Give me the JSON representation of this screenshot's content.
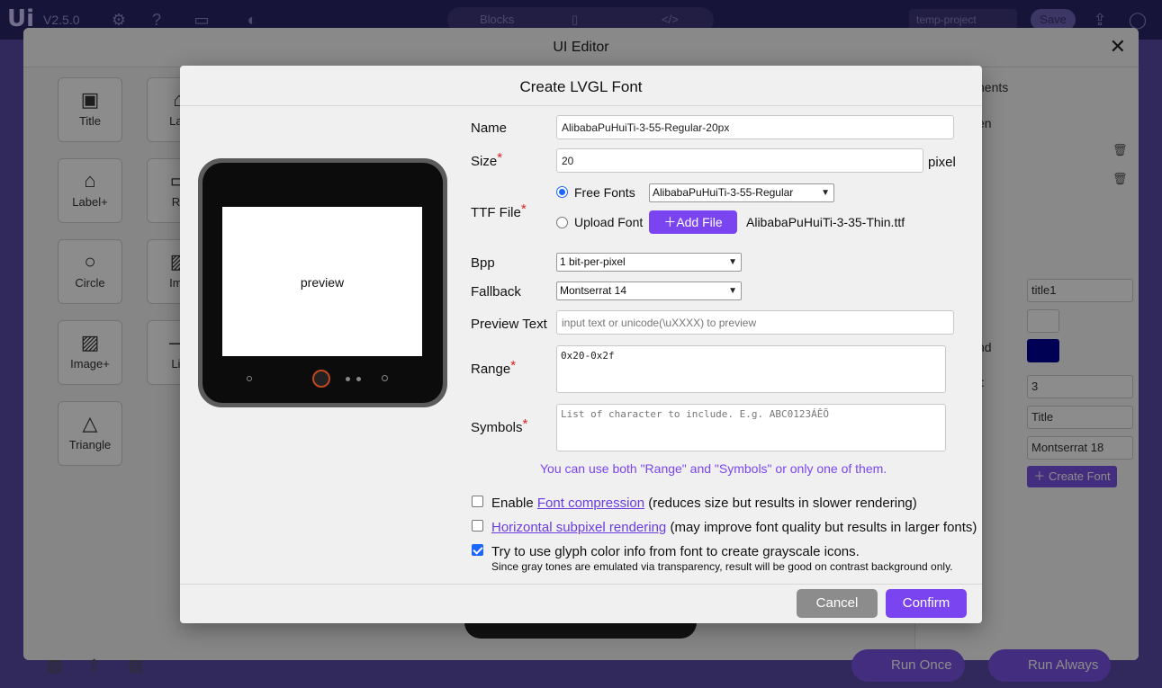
{
  "app": {
    "logo": "Ui",
    "version": "V2.5.0",
    "tabs": [
      "Blocks",
      "",
      "</>"
    ],
    "project": "temp-project",
    "save_label": "Save"
  },
  "editor": {
    "title": "UI Editor",
    "close_glyph": "✕",
    "palette": [
      {
        "label": "Title",
        "icon": "title-icon"
      },
      {
        "label": "Label+",
        "icon": "label-plus-icon"
      },
      {
        "label": "Circle",
        "icon": "circle-icon"
      },
      {
        "label": "Image+",
        "icon": "image-plus-icon"
      },
      {
        "label": "Triangle",
        "icon": "triangle-icon"
      },
      {
        "label": "Lab",
        "icon": "label-icon"
      },
      {
        "label": "Re",
        "icon": "rectangle-icon"
      },
      {
        "label": "Ima",
        "icon": "image-icon"
      },
      {
        "label": "Lin",
        "icon": "line-icon"
      }
    ],
    "right_panel": {
      "components_heading": "nents",
      "screen_label": "en",
      "bg_label": "nd",
      "size_label": "t:",
      "id_value": "title1",
      "size_value": "3",
      "text_value": "Title",
      "font_value": "Montserrat 18",
      "create_font_label": "Create Font",
      "bg_color": "#000099"
    },
    "run_once": "Run Once",
    "run_always": "Run Always"
  },
  "dialog": {
    "title": "Create LVGL Font",
    "preview_text": "preview",
    "name_label": "Name",
    "name_value": "AlibabaPuHuiTi-3-55-Regular-20px",
    "size_label": "Size",
    "size_value": "20",
    "size_unit": "pixel",
    "ttf_label": "TTF File",
    "free_fonts_label": "Free Fonts",
    "free_fonts_selected": "AlibabaPuHuiTi-3-55-Regular",
    "upload_font_label": "Upload Font",
    "add_file_label": "Add File",
    "uploaded_file": "AlibabaPuHuiTi-3-35-Thin.ttf",
    "bpp_label": "Bpp",
    "bpp_selected": "1 bit-per-pixel",
    "fallback_label": "Fallback",
    "fallback_selected": "Montserrat 14",
    "preview_text_label": "Preview Text",
    "preview_text_placeholder": "input text or unicode(\\uXXXX) to preview",
    "range_label": "Range",
    "range_value": "0x20-0x2f",
    "symbols_label": "Symbols",
    "symbols_placeholder": "List of character to include. E.g. ABC0123ÁÊÕ",
    "hint": "You can use both \"Range\" and \"Symbols\" or only one of them.",
    "opt_compression_prefix": "Enable",
    "opt_compression_link": "Font compression",
    "opt_compression_suffix": "(reduces size but results in slower rendering)",
    "opt_compression_checked": false,
    "opt_subpixel_link": "Horizontal subpixel rendering",
    "opt_subpixel_suffix": "(may improve font quality but results in larger fonts)",
    "opt_subpixel_checked": false,
    "opt_glyph_color": "Try to use glyph color info from font to create grayscale icons.",
    "opt_glyph_color_note": "Since gray tones are emulated via transparency, result will be good on contrast background only.",
    "opt_glyph_color_checked": true,
    "cancel_label": "Cancel",
    "confirm_label": "Confirm",
    "required_mark": "*"
  }
}
